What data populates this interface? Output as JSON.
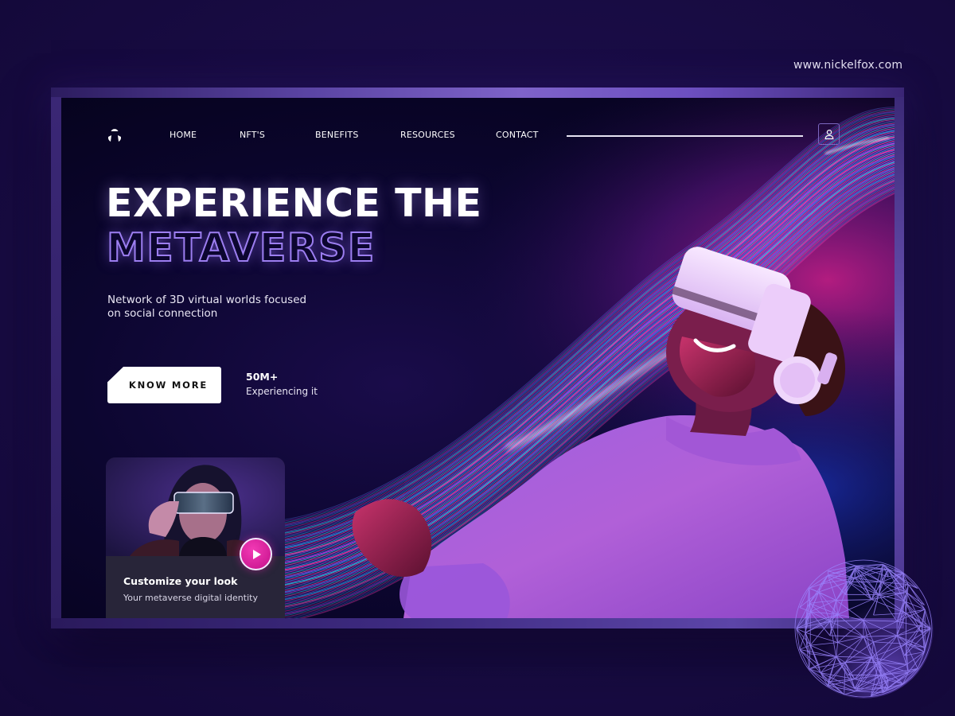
{
  "watermark": {
    "url": "www.nickelfox.com"
  },
  "nav": {
    "logo_icon": "tri-segment-logo-icon",
    "items": [
      {
        "label": "HOME"
      },
      {
        "label": "NFT'S"
      },
      {
        "label": "BENEFITS"
      },
      {
        "label": "RESOURCES"
      },
      {
        "label": "CONTACT"
      }
    ],
    "user_icon": "user-icon"
  },
  "hero": {
    "title_line1": "EXPERIENCE THE",
    "title_line2": "METAVERSE",
    "subtitle": "Network of 3D virtual worlds focused on social connection",
    "cta_label": "KNOW MORE",
    "stat_value": "50M+",
    "stat_label": "Experiencing it"
  },
  "card": {
    "title": "Customize your look",
    "subtitle": "Your metaverse digital identity",
    "play_icon": "play-icon"
  },
  "colors": {
    "accent_purple": "#9c7ef0",
    "play_pink": "#e0249f",
    "background": "#1a0d47",
    "screen_bg": "#0c0630"
  }
}
